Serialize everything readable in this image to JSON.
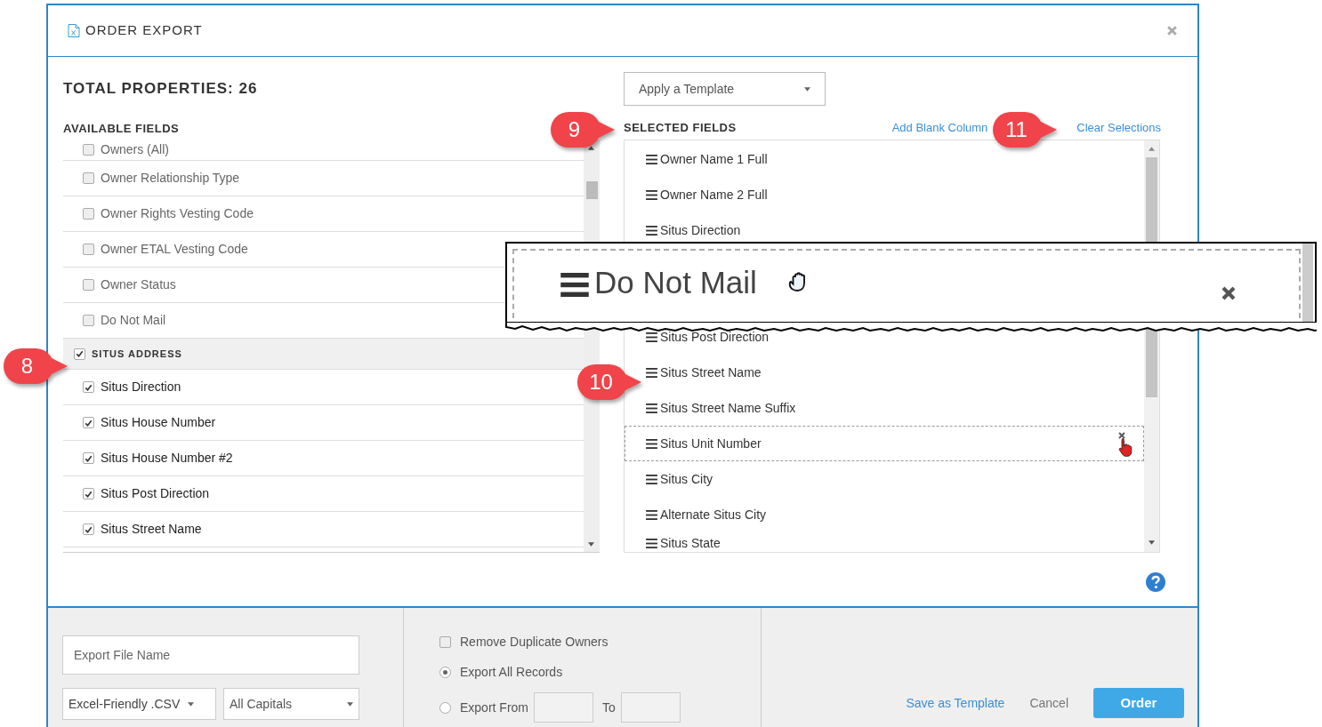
{
  "window": {
    "title": "ORDER EXPORT"
  },
  "total_properties": "TOTAL PROPERTIES: 26",
  "template_select": {
    "value": "Apply a Template"
  },
  "available_fields": {
    "heading": "AVAILABLE FIELDS",
    "items": [
      {
        "kind": "field",
        "label": "Owners (All)",
        "checked": false
      },
      {
        "kind": "field",
        "label": "Owner Relationship Type",
        "checked": false
      },
      {
        "kind": "field",
        "label": "Owner Rights Vesting Code",
        "checked": false
      },
      {
        "kind": "field",
        "label": "Owner ETAL Vesting Code",
        "checked": false
      },
      {
        "kind": "field",
        "label": "Owner Status",
        "checked": false
      },
      {
        "kind": "field",
        "label": "Do Not Mail",
        "checked": false
      },
      {
        "kind": "group",
        "label": "SITUS ADDRESS",
        "checked": true
      },
      {
        "kind": "field",
        "label": "Situs Direction",
        "checked": true
      },
      {
        "kind": "field",
        "label": "Situs House Number",
        "checked": true
      },
      {
        "kind": "field",
        "label": "Situs House Number #2",
        "checked": true
      },
      {
        "kind": "field",
        "label": "Situs Post Direction",
        "checked": true
      },
      {
        "kind": "field",
        "label": "Situs Street Name",
        "checked": true
      }
    ]
  },
  "selected_fields": {
    "heading": "SELECTED FIELDS",
    "add_blank": "Add Blank Column",
    "clear": "Clear Selections",
    "items": [
      {
        "label": "Owner Name 1 Full",
        "hovered": false
      },
      {
        "label": "Owner Name 2 Full",
        "hovered": false
      },
      {
        "label": "Situs Direction",
        "hovered": false
      },
      {
        "kind": "hidden"
      },
      {
        "label": "Situs Post Direction",
        "hovered": false
      },
      {
        "label": "Situs Street Name",
        "hovered": false
      },
      {
        "label": "Situs Street Name Suffix",
        "hovered": false
      },
      {
        "label": "Situs Unit Number",
        "hovered": true
      },
      {
        "label": "Situs City",
        "hovered": false
      },
      {
        "label": "Alternate Situs City",
        "hovered": false
      },
      {
        "label": "Situs State",
        "hovered": false
      }
    ]
  },
  "drag_zoom": {
    "label": "Do Not Mail"
  },
  "callouts": [
    "8",
    "9",
    "10",
    "11"
  ],
  "footer": {
    "file_name": {
      "placeholder": "Export File Name"
    },
    "format": "Excel-Friendly .CSV",
    "case": "All Capitals",
    "remove_duplicates": {
      "label": "Remove Duplicate Owners",
      "checked": false
    },
    "records": [
      {
        "label": "Export All Records",
        "selected": true
      },
      {
        "label": "Export From",
        "selected": false
      }
    ],
    "to_label": "To",
    "save_template": "Save as Template",
    "cancel": "Cancel",
    "order": "Order"
  }
}
